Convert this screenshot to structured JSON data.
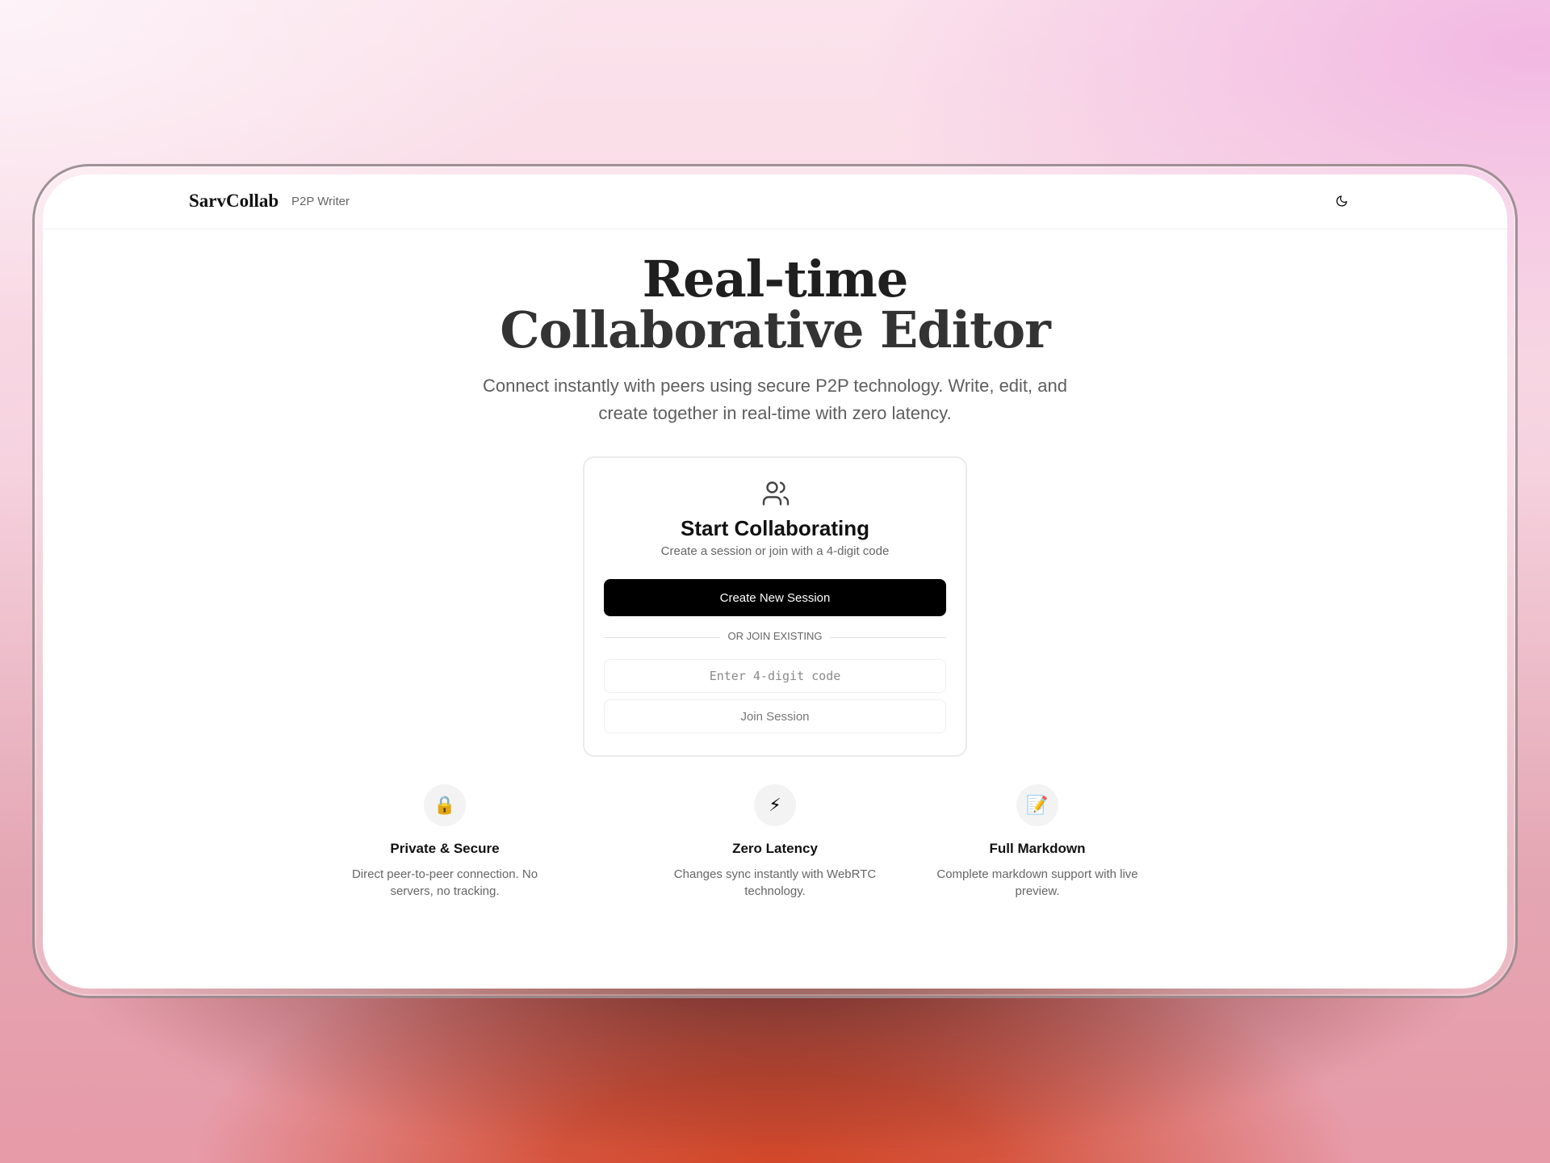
{
  "brand": {
    "name": "SarvCollab",
    "tag": "P2P Writer"
  },
  "icons": {
    "theme": "moon-icon",
    "users": "users-icon"
  },
  "hero": {
    "title_line1": "Real-time",
    "title_line2": "Collaborative Editor",
    "subtitle": "Connect instantly with peers using secure P2P technology. Write, edit, and create together in real-time with zero latency."
  },
  "card": {
    "title": "Start Collaborating",
    "subtitle": "Create a session or join with a 4-digit code",
    "create_label": "Create New Session",
    "divider_label": "OR JOIN EXISTING",
    "code_placeholder": "Enter 4-digit code",
    "join_label": "Join Session"
  },
  "features": [
    {
      "icon": "🔒",
      "icon_name": "lock-icon",
      "title": "Private & Secure",
      "description": "Direct peer-to-peer connection. No servers, no tracking."
    },
    {
      "icon": "⚡",
      "icon_name": "lightning-icon",
      "title": "Zero Latency",
      "description": "Changes sync instantly with WebRTC technology."
    },
    {
      "icon": "📝",
      "icon_name": "memo-icon",
      "title": "Full Markdown",
      "description": "Complete markdown support with live preview."
    }
  ],
  "colors": {
    "primary_button": "#000000",
    "text": "#111111",
    "muted": "#666666"
  }
}
